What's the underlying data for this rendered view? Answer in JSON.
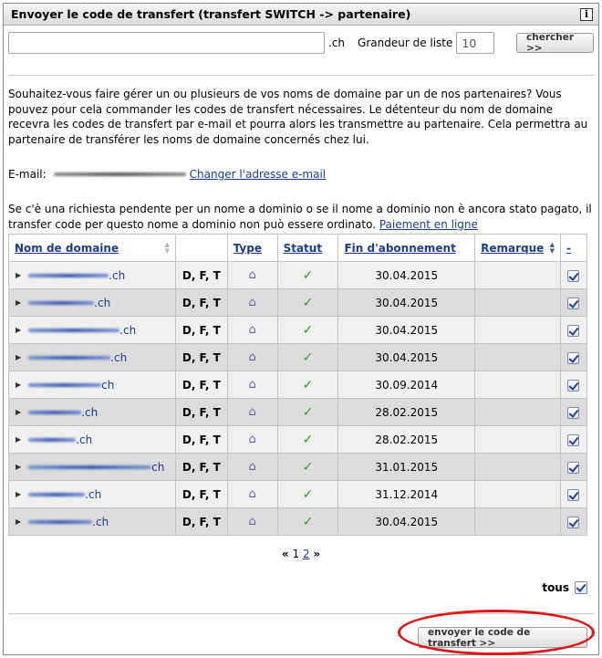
{
  "header": {
    "title": "Envoyer le code de transfert (transfert SWITCH -> partenaire)",
    "info_icon": "i"
  },
  "search": {
    "domain_value": "",
    "suffix": ".ch",
    "list_size_label": "Grandeur de liste",
    "list_size_value": "10",
    "search_button": "chercher >>"
  },
  "intro_text": "Souhaitez-vous faire gérer un ou plusieurs de vos noms de domaine par un de nos partenaires? Vous pouvez pour cela commander les codes de transfert nécessaires. Le détenteur du nom de domaine recevra les codes de transfert par e-mail et pourra alors les transmettre au partenaire. Cela permettra au partenaire de transférer les noms de domaine concernés chez lui.",
  "email": {
    "label": "E-mail:",
    "change_link": "Changer l'adresse e-mail"
  },
  "notice": {
    "text": "Se c'è una richiesta pendente per un nome a dominio o se il nome a dominio non è ancora stato pagato, il transfer code per questo nome a dominio non può essere ordinato.",
    "link": "Paiement en ligne"
  },
  "table": {
    "columns": {
      "domain": "Nom de domaine",
      "type": "Type",
      "status": "Statut",
      "expiry": "Fin d'abonnement",
      "remark": "Remarque",
      "select": "-"
    },
    "rows": [
      {
        "tld": ".ch",
        "flags": "D, F, T",
        "expiry": "30.04.2015"
      },
      {
        "tld": ".ch",
        "flags": "D, F, T",
        "expiry": "30.04.2015"
      },
      {
        "tld": ".ch",
        "flags": "D, F, T",
        "expiry": "30.04.2015"
      },
      {
        "tld": ".ch",
        "flags": "D, F, T",
        "expiry": "30.04.2015"
      },
      {
        "tld": "ch",
        "flags": "D, F, T",
        "expiry": "30.09.2014"
      },
      {
        "tld": ".ch",
        "flags": "D, F, T",
        "expiry": "28.02.2015"
      },
      {
        "tld": ".ch",
        "flags": "D, F, T",
        "expiry": "28.02.2015"
      },
      {
        "tld": "ch",
        "flags": "D, F, T",
        "expiry": "31.01.2015"
      },
      {
        "tld": ".ch",
        "flags": "D, F, T",
        "expiry": "31.12.2014"
      },
      {
        "tld": ".ch",
        "flags": "D, F, T",
        "expiry": "30.04.2015"
      }
    ]
  },
  "pager": {
    "prev": "«",
    "current": "1",
    "next_page": "2",
    "next": "»"
  },
  "select_all_label": "tous",
  "send_button": "envoyer le code de transfert >>",
  "colors": {
    "link": "#1a3d8f",
    "check": "#2e9a2e",
    "highlight": "#e01515"
  }
}
